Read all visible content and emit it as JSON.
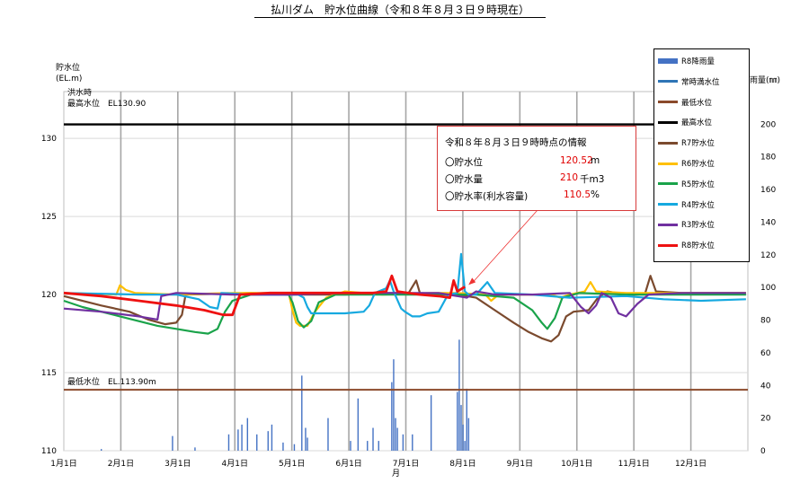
{
  "title": "払川ダム　貯水位曲線（令和８年８月３日９時現在）",
  "y_left_label": [
    "貯水位",
    "(EL.m)"
  ],
  "y_right_label": "雨量(㎜)",
  "x_axis_unit": "月",
  "flood_label": [
    "洪水時",
    "最高水位　EL130.90"
  ],
  "min_label": "最低水位　EL.113.90m",
  "info": {
    "head": "令和８年８月３日９時時点の情報",
    "rows": [
      {
        "label": "〇貯水位",
        "value": "120.52",
        "unit": "m"
      },
      {
        "label": "〇貯水量",
        "value": "210",
        "unit": "千m3"
      },
      {
        "label": "〇貯水率(利水容量)",
        "value": "110.5",
        "unit": "%"
      }
    ]
  },
  "legend": [
    {
      "name": "R8降雨量",
      "color": "#4472c4",
      "kind": "bar"
    },
    {
      "name": "常時満水位",
      "color": "#2e75b6",
      "kind": "line"
    },
    {
      "name": "最低水位",
      "color": "#8b4a2b",
      "kind": "line"
    },
    {
      "name": "最高水位",
      "color": "#000000",
      "kind": "line"
    },
    {
      "name": "R7貯水位",
      "color": "#7b4a2e",
      "kind": "line"
    },
    {
      "name": "R6貯水位",
      "color": "#ffc000",
      "kind": "line"
    },
    {
      "name": "R5貯水位",
      "color": "#1aa34a",
      "kind": "line"
    },
    {
      "name": "R4貯水位",
      "color": "#16a9e0",
      "kind": "line"
    },
    {
      "name": "R3貯水位",
      "color": "#7030a0",
      "kind": "line"
    },
    {
      "name": "R8貯水位",
      "color": "#ee1111",
      "kind": "line"
    }
  ],
  "chart_data": {
    "type": "line",
    "title": "払川ダム　貯水位曲線（令和８年８月３日９時現在）",
    "x_ticks": [
      "1月1日",
      "2月1日",
      "3月1日",
      "4月1日",
      "5月1日",
      "6月1日",
      "7月1日",
      "8月1日",
      "9月1日",
      "10月1日",
      "11月1日",
      "12月1日"
    ],
    "y_left": {
      "label": "貯水位 (EL.m)",
      "range": [
        110,
        133
      ],
      "ticks": [
        110,
        115,
        120,
        125,
        130
      ]
    },
    "y_right": {
      "label": "雨量(㎜)",
      "range": [
        0,
        220
      ],
      "ticks": [
        0,
        20,
        40,
        60,
        80,
        100,
        120,
        140,
        160,
        180,
        200
      ]
    },
    "reference_lines": [
      {
        "name": "最高水位",
        "value": 130.9,
        "color": "#000000"
      },
      {
        "name": "最低水位",
        "value": 113.9,
        "color": "#8b4a2b"
      }
    ],
    "series": [
      {
        "name": "R7貯水位",
        "color": "#7b4a2e",
        "points": [
          [
            0,
            119.9
          ],
          [
            20,
            119.3
          ],
          [
            35,
            118.9
          ],
          [
            45,
            118.4
          ],
          [
            54,
            118.1
          ],
          [
            60,
            118.2
          ],
          [
            63,
            118.7
          ],
          [
            65,
            120.0
          ],
          [
            100,
            120.1
          ],
          [
            120,
            120.0
          ],
          [
            150,
            120.0
          ],
          [
            170,
            120.1
          ],
          [
            184,
            120.1
          ],
          [
            188,
            120.9
          ],
          [
            190,
            120.1
          ],
          [
            210,
            120.0
          ],
          [
            220,
            119.8
          ],
          [
            230,
            119.0
          ],
          [
            240,
            118.2
          ],
          [
            248,
            117.6
          ],
          [
            255,
            117.2
          ],
          [
            260,
            117.0
          ],
          [
            264,
            117.4
          ],
          [
            268,
            118.6
          ],
          [
            272,
            118.9
          ],
          [
            280,
            119.0
          ],
          [
            285,
            119.8
          ],
          [
            290,
            120.2
          ],
          [
            300,
            120.0
          ],
          [
            310,
            120.0
          ],
          [
            313,
            121.2
          ],
          [
            316,
            120.2
          ],
          [
            330,
            120.1
          ],
          [
            364,
            120.1
          ]
        ]
      },
      {
        "name": "R6貯水位",
        "color": "#ffc000",
        "points": [
          [
            0,
            120.1
          ],
          [
            28,
            120.0
          ],
          [
            30,
            120.6
          ],
          [
            33,
            120.3
          ],
          [
            38,
            120.1
          ],
          [
            60,
            120.0
          ],
          [
            90,
            120.1
          ],
          [
            120,
            120.1
          ],
          [
            122,
            119.0
          ],
          [
            124,
            118.2
          ],
          [
            126,
            118.0
          ],
          [
            130,
            118.0
          ],
          [
            134,
            118.9
          ],
          [
            140,
            119.8
          ],
          [
            150,
            120.2
          ],
          [
            170,
            120.0
          ],
          [
            195,
            120.1
          ],
          [
            210,
            120.1
          ],
          [
            225,
            120.0
          ],
          [
            228,
            119.6
          ],
          [
            232,
            120.0
          ],
          [
            260,
            120.0
          ],
          [
            265,
            119.8
          ],
          [
            270,
            120.0
          ],
          [
            278,
            120.2
          ],
          [
            281,
            120.8
          ],
          [
            284,
            120.2
          ],
          [
            300,
            120.1
          ],
          [
            364,
            120.1
          ]
        ]
      },
      {
        "name": "R5貯水位",
        "color": "#1aa34a",
        "points": [
          [
            0,
            119.6
          ],
          [
            10,
            119.2
          ],
          [
            20,
            118.9
          ],
          [
            30,
            118.6
          ],
          [
            40,
            118.3
          ],
          [
            50,
            118.0
          ],
          [
            60,
            117.8
          ],
          [
            70,
            117.6
          ],
          [
            77,
            117.5
          ],
          [
            82,
            117.8
          ],
          [
            86,
            118.9
          ],
          [
            90,
            119.6
          ],
          [
            100,
            120.0
          ],
          [
            120,
            120.0
          ],
          [
            122,
            119.5
          ],
          [
            125,
            118.3
          ],
          [
            128,
            117.9
          ],
          [
            132,
            118.3
          ],
          [
            136,
            119.5
          ],
          [
            145,
            120.0
          ],
          [
            170,
            120.0
          ],
          [
            200,
            120.0
          ],
          [
            220,
            120.0
          ],
          [
            240,
            119.8
          ],
          [
            250,
            119.0
          ],
          [
            255,
            118.2
          ],
          [
            258,
            117.8
          ],
          [
            262,
            118.5
          ],
          [
            266,
            119.8
          ],
          [
            275,
            120.1
          ],
          [
            300,
            120.0
          ],
          [
            340,
            120.0
          ],
          [
            364,
            120.0
          ]
        ]
      },
      {
        "name": "R4貯水位",
        "color": "#16a9e0",
        "points": [
          [
            0,
            120.1
          ],
          [
            40,
            120.0
          ],
          [
            60,
            120.0
          ],
          [
            72,
            119.7
          ],
          [
            78,
            119.2
          ],
          [
            82,
            119.1
          ],
          [
            84,
            120.1
          ],
          [
            100,
            120.0
          ],
          [
            125,
            120.0
          ],
          [
            128,
            119.8
          ],
          [
            130,
            119.2
          ],
          [
            132,
            118.8
          ],
          [
            150,
            118.8
          ],
          [
            160,
            118.9
          ],
          [
            163,
            119.3
          ],
          [
            166,
            120.1
          ],
          [
            172,
            120.4
          ],
          [
            174,
            120.9
          ],
          [
            176,
            120.2
          ],
          [
            180,
            119.1
          ],
          [
            182,
            118.9
          ],
          [
            186,
            118.6
          ],
          [
            190,
            118.6
          ],
          [
            194,
            118.8
          ],
          [
            200,
            118.9
          ],
          [
            205,
            120.0
          ],
          [
            210,
            120.1
          ],
          [
            212,
            122.6
          ],
          [
            214,
            120.2
          ],
          [
            216,
            120.0
          ],
          [
            220,
            120.0
          ],
          [
            226,
            120.8
          ],
          [
            230,
            120.1
          ],
          [
            250,
            120.0
          ],
          [
            270,
            119.8
          ],
          [
            300,
            119.9
          ],
          [
            320,
            119.7
          ],
          [
            340,
            119.6
          ],
          [
            364,
            119.7
          ]
        ]
      },
      {
        "name": "R3貯水位",
        "color": "#7030a0",
        "points": [
          [
            0,
            119.1
          ],
          [
            20,
            118.9
          ],
          [
            40,
            118.6
          ],
          [
            50,
            118.4
          ],
          [
            52,
            119.9
          ],
          [
            60,
            120.1
          ],
          [
            90,
            120.0
          ],
          [
            120,
            120.0
          ],
          [
            150,
            120.1
          ],
          [
            180,
            120.1
          ],
          [
            200,
            120.1
          ],
          [
            215,
            119.8
          ],
          [
            220,
            120.2
          ],
          [
            230,
            120.0
          ],
          [
            250,
            120.0
          ],
          [
            270,
            120.1
          ],
          [
            276,
            119.2
          ],
          [
            280,
            118.8
          ],
          [
            284,
            119.3
          ],
          [
            287,
            120.1
          ],
          [
            292,
            119.8
          ],
          [
            296,
            118.8
          ],
          [
            300,
            118.6
          ],
          [
            306,
            119.4
          ],
          [
            312,
            120.0
          ],
          [
            330,
            120.1
          ],
          [
            364,
            120.1
          ]
        ]
      },
      {
        "name": "R8貯水位",
        "color": "#ee1111",
        "points": [
          [
            0,
            120.1
          ],
          [
            20,
            119.9
          ],
          [
            40,
            119.6
          ],
          [
            60,
            119.3
          ],
          [
            75,
            119.0
          ],
          [
            85,
            118.7
          ],
          [
            90,
            118.7
          ],
          [
            94,
            120.0
          ],
          [
            110,
            120.1
          ],
          [
            130,
            120.1
          ],
          [
            150,
            120.1
          ],
          [
            165,
            120.1
          ],
          [
            172,
            120.2
          ],
          [
            175,
            121.2
          ],
          [
            178,
            120.2
          ],
          [
            190,
            120.0
          ],
          [
            200,
            119.9
          ],
          [
            206,
            119.8
          ],
          [
            208,
            120.9
          ],
          [
            210,
            120.2
          ],
          [
            214,
            120.5
          ]
        ]
      }
    ],
    "rain": {
      "name": "R8降雨量",
      "color": "#4472c4",
      "bars": [
        [
          20,
          1
        ],
        [
          58,
          9
        ],
        [
          70,
          2
        ],
        [
          88,
          10
        ],
        [
          93,
          13
        ],
        [
          95,
          16
        ],
        [
          98,
          20
        ],
        [
          103,
          10
        ],
        [
          109,
          12
        ],
        [
          111,
          16
        ],
        [
          117,
          5
        ],
        [
          123,
          4
        ],
        [
          127,
          46
        ],
        [
          129,
          14
        ],
        [
          130,
          8
        ],
        [
          141,
          20
        ],
        [
          153,
          6
        ],
        [
          157,
          32
        ],
        [
          162,
          6
        ],
        [
          165,
          14
        ],
        [
          168,
          6
        ],
        [
          175,
          42
        ],
        [
          176,
          56
        ],
        [
          177,
          20
        ],
        [
          178,
          14
        ],
        [
          181,
          10
        ],
        [
          186,
          10
        ],
        [
          196,
          34
        ],
        [
          210,
          36
        ],
        [
          211,
          68
        ],
        [
          212,
          28
        ],
        [
          213,
          16
        ],
        [
          214,
          6
        ],
        [
          215,
          38
        ],
        [
          216,
          20
        ]
      ]
    }
  }
}
